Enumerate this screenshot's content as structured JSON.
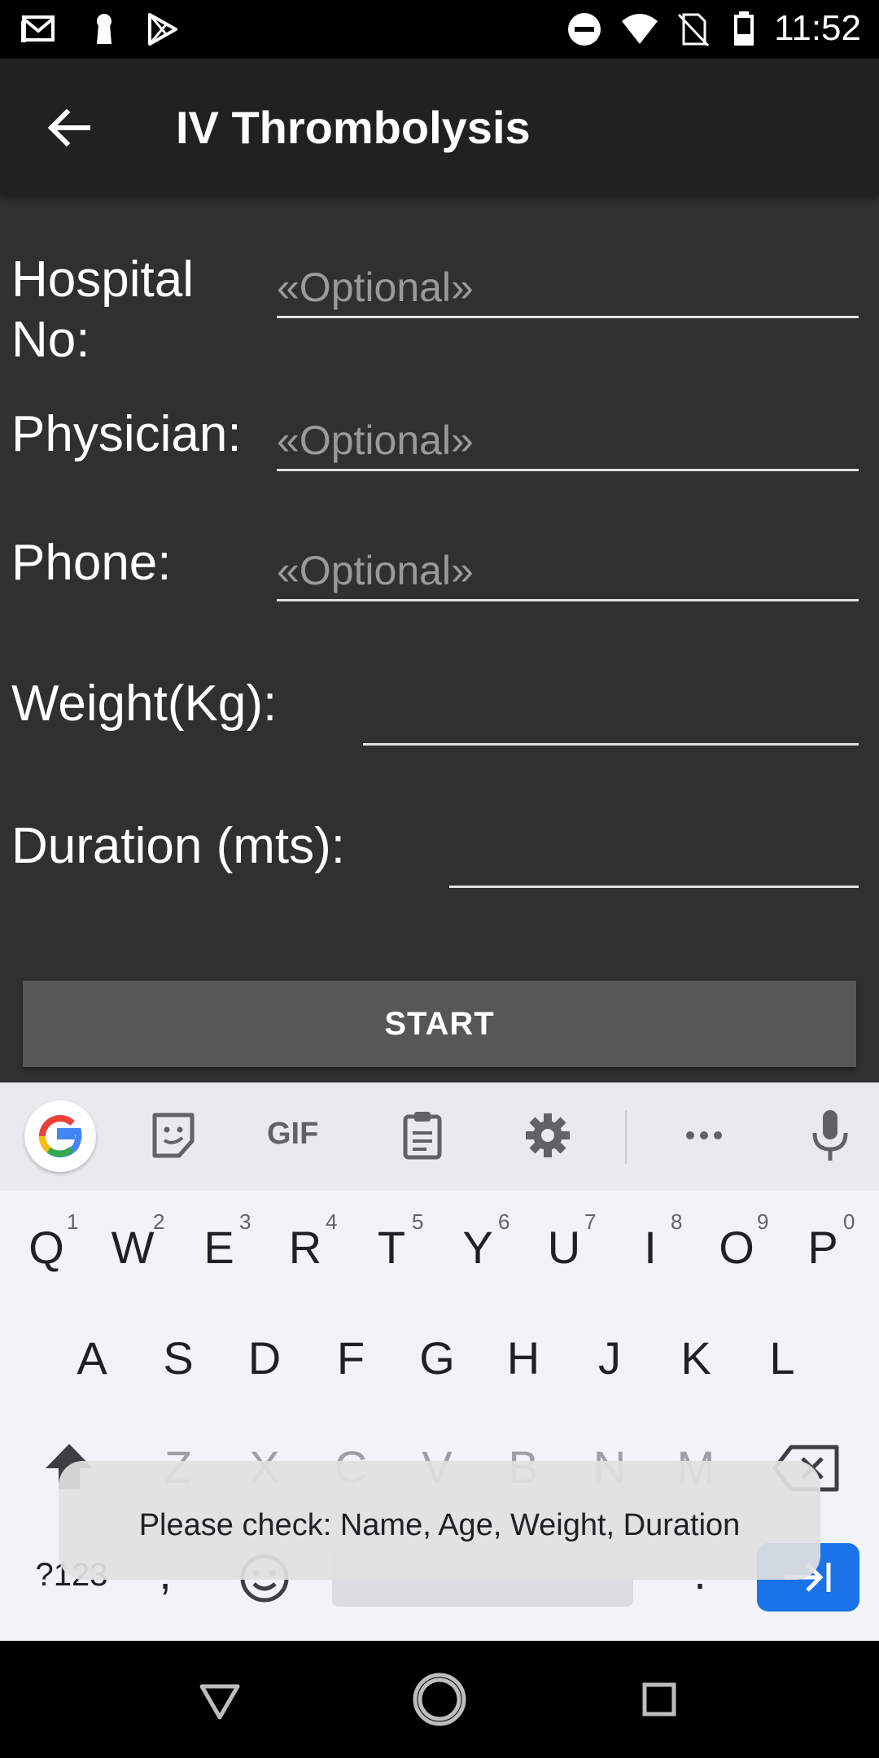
{
  "status_bar": {
    "time": "11:52",
    "icons": [
      "gmail-icon",
      "keyhole-icon",
      "play-store-icon",
      "do-not-disturb-icon",
      "wifi-icon",
      "no-sim-icon",
      "battery-icon"
    ]
  },
  "app_bar": {
    "title": "IV Thrombolysis",
    "back_icon": "back-arrow-icon"
  },
  "form": {
    "hospital_no": {
      "label": "Hospital\nNo:",
      "placeholder": "«Optional»",
      "value": ""
    },
    "physician": {
      "label": "Physician:",
      "placeholder": "«Optional»",
      "value": ""
    },
    "phone": {
      "label": "Phone:",
      "placeholder": "«Optional»",
      "value": ""
    },
    "weight": {
      "label": "Weight(Kg):",
      "placeholder": "",
      "value": ""
    },
    "duration": {
      "label": "Duration (mts):",
      "placeholder": "",
      "value": ""
    },
    "start_label": "START"
  },
  "keyboard": {
    "toolbar": {
      "gif_label": "GIF"
    },
    "row1": [
      {
        "key": "Q",
        "hint": "1"
      },
      {
        "key": "W",
        "hint": "2"
      },
      {
        "key": "E",
        "hint": "3"
      },
      {
        "key": "R",
        "hint": "4"
      },
      {
        "key": "T",
        "hint": "5"
      },
      {
        "key": "Y",
        "hint": "6"
      },
      {
        "key": "U",
        "hint": "7"
      },
      {
        "key": "I",
        "hint": "8"
      },
      {
        "key": "O",
        "hint": "9"
      },
      {
        "key": "P",
        "hint": "0"
      }
    ],
    "row2": [
      "A",
      "S",
      "D",
      "F",
      "G",
      "H",
      "J",
      "K",
      "L"
    ],
    "row3": [
      "Z",
      "X",
      "C",
      "V",
      "B",
      "N",
      "M"
    ],
    "row4": {
      "symbols": "?123",
      "comma": ",",
      "period": "."
    }
  },
  "toast": {
    "message": "Please check: Name, Age, Weight, Duration"
  },
  "colors": {
    "background": "#303030",
    "app_bar": "#212121",
    "button": "#575757",
    "keyboard": "#f1f3f6",
    "accent": "#1a73e8"
  }
}
